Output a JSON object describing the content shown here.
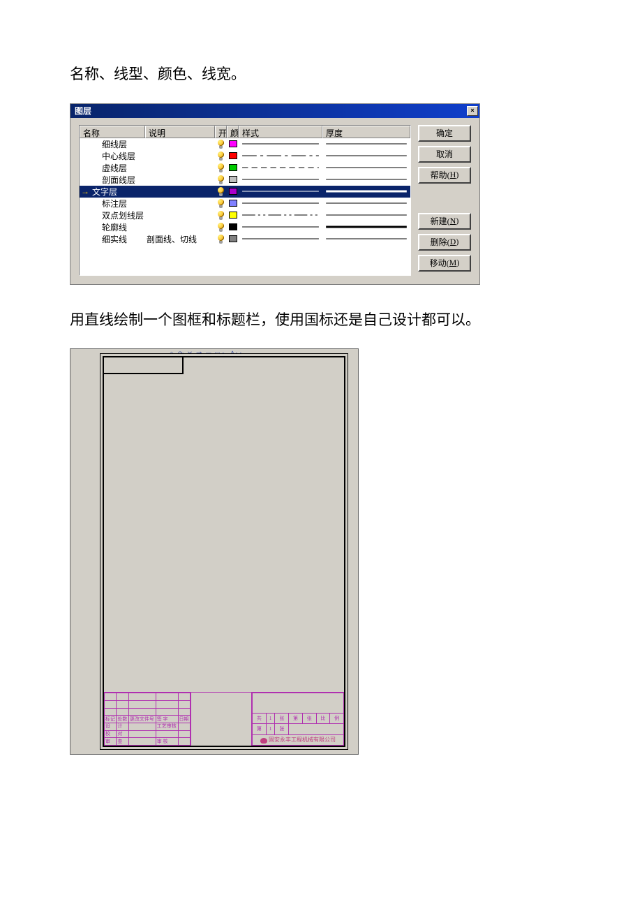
{
  "text": {
    "intro": "名称、线型、颜色、线宽。",
    "instruction": "用直线绘制一个图框和标题栏，使用国标还是自己设计都可以。"
  },
  "dialog": {
    "title": "图层",
    "close": "×",
    "columns": {
      "name": "名称",
      "desc": "说明",
      "on": "开",
      "color": "颜",
      "style": "样式",
      "thick": "厚度"
    },
    "buttons": {
      "ok": "确定",
      "cancel": "取消",
      "help_pre": "帮助(",
      "help_key": "H",
      "help_post": ")",
      "new_pre": "新建(",
      "new_key": "N",
      "new_post": ")",
      "del_pre": "删除(",
      "del_key": "D",
      "del_post": ")",
      "move_pre": "移动(",
      "move_key": "M",
      "move_post": ")"
    },
    "layers": [
      {
        "name": "细线层",
        "desc": "",
        "color": "#ff00ff",
        "dash": "solid",
        "weight": 1,
        "selected": false
      },
      {
        "name": "中心线层",
        "desc": "",
        "color": "#ff0000",
        "dash": "center",
        "weight": 1,
        "selected": false
      },
      {
        "name": "虚线层",
        "desc": "",
        "color": "#00cc00",
        "dash": "dash",
        "weight": 1,
        "selected": false
      },
      {
        "name": "剖面线层",
        "desc": "",
        "color": "#c0c0c0",
        "dash": "solid",
        "weight": 1,
        "selected": false
      },
      {
        "name": "文字层",
        "desc": "",
        "color": "#aa00cc",
        "dash": "solid",
        "weight": 3,
        "selected": true
      },
      {
        "name": "标注层",
        "desc": "",
        "color": "#8080ff",
        "dash": "solid",
        "weight": 1,
        "selected": false
      },
      {
        "name": "双点划线层",
        "desc": "",
        "color": "#ffff00",
        "dash": "phantom",
        "weight": 1,
        "selected": false
      },
      {
        "name": "轮廓线",
        "desc": "",
        "color": "#000000",
        "dash": "solid",
        "weight": 3,
        "selected": false
      },
      {
        "name": "细实线",
        "desc": "剖面线、切线",
        "color": "#808080",
        "dash": "solid",
        "weight": 1,
        "selected": false
      }
    ]
  },
  "drawing": {
    "toolbar_hint": "◇ ⟳  ✕ ⇄  ▭ □ ▸ ⋀▸▸",
    "title_block": {
      "left_header": [
        "标记",
        "处数",
        "更改文件号",
        "签 字",
        "日期"
      ],
      "left_rows": [
        [
          "设",
          "计",
          "",
          "工艺审核",
          ""
        ],
        [
          "校",
          "对",
          "",
          "",
          ""
        ],
        [
          "审",
          "查",
          "",
          "审 核",
          ""
        ]
      ],
      "right_top": [
        "共",
        "1",
        "张",
        "第",
        "张",
        "比",
        "例"
      ],
      "right_mid": [
        "第",
        "1",
        "张"
      ],
      "company": "固安永丰工程机械有限公司"
    }
  }
}
